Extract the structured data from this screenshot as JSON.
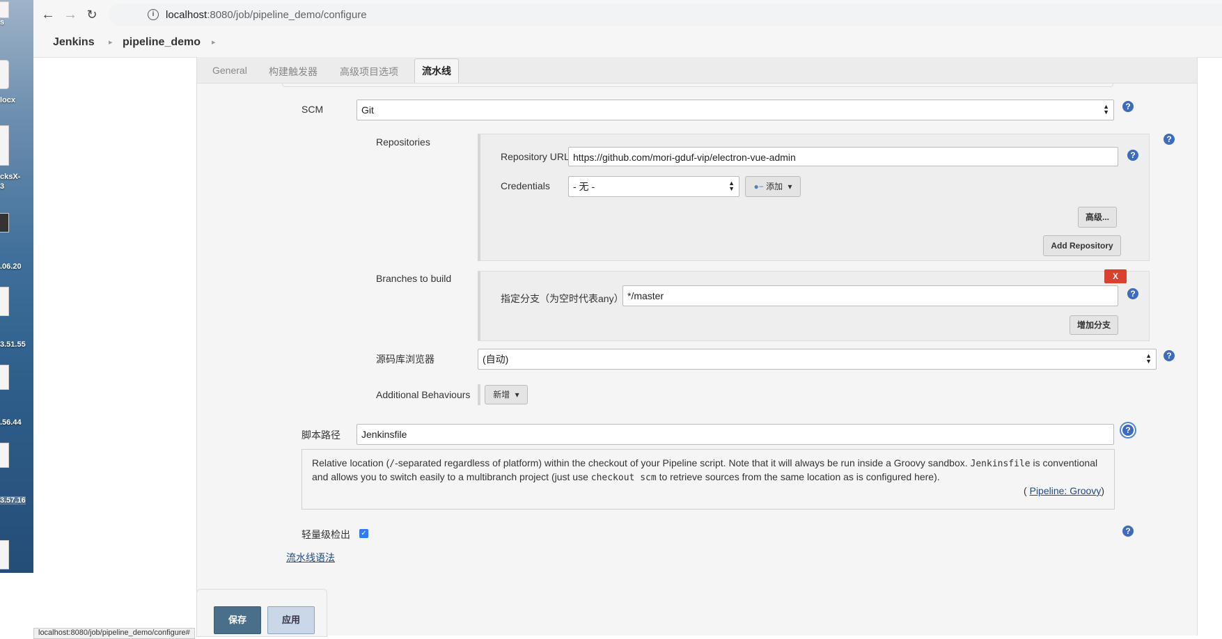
{
  "desktop": {
    "labels": [
      "s",
      "locx",
      "cksX-",
      "3",
      ".06.20",
      "3.51.55",
      ".56.44",
      "3.57.16"
    ]
  },
  "browser": {
    "url_host": "localhost",
    "url_path": ":8080/job/pipeline_demo/configure"
  },
  "breadcrumb": {
    "items": [
      "Jenkins",
      "pipeline_demo"
    ]
  },
  "tabs": [
    "General",
    "构建触发器",
    "高级项目选项",
    "流水线"
  ],
  "scm": {
    "label": "SCM",
    "value": "Git"
  },
  "repositories": {
    "label": "Repositories",
    "url_label": "Repository URL",
    "url_value": "https://github.com/mori-gduf-vip/electron-vue-admin",
    "credentials_label": "Credentials",
    "credentials_value": "- 无 -",
    "add_button": "添加",
    "advanced_button": "高级...",
    "add_repository_button": "Add Repository"
  },
  "branches": {
    "label": "Branches to build",
    "delete_button": "X",
    "specifier_label": "指定分支（为空时代表any）",
    "specifier_value": "*/master",
    "add_branch_button": "增加分支"
  },
  "browser_field": {
    "label": "源码库浏览器",
    "value": "(自动)"
  },
  "behaviours": {
    "label": "Additional Behaviours",
    "add_button": "新增"
  },
  "script_path": {
    "label": "脚本路径",
    "value": "Jenkinsfile"
  },
  "description": {
    "text_1": "Relative location (",
    "code_1": "/",
    "text_2": "-separated regardless of platform) within the checkout of your Pipeline script. Note that it will always be run inside a Groovy sandbox.",
    "code_2": "Jenkinsfile",
    "text_3": "is conventional and allows you to switch easily to a multibranch project (just use",
    "code_3": "checkout scm",
    "text_4": "to retrieve sources from the same location as is configured here).",
    "link_prefix": "(",
    "link_text": "Pipeline: Groovy",
    "link_suffix": ")"
  },
  "lightweight": {
    "label": "轻量级检出",
    "checked": true
  },
  "pipeline_syntax_link": "流水线语法",
  "actions": {
    "save": "保存",
    "apply": "应用"
  },
  "status_url": "localhost:8080/job/pipeline_demo/configure#"
}
